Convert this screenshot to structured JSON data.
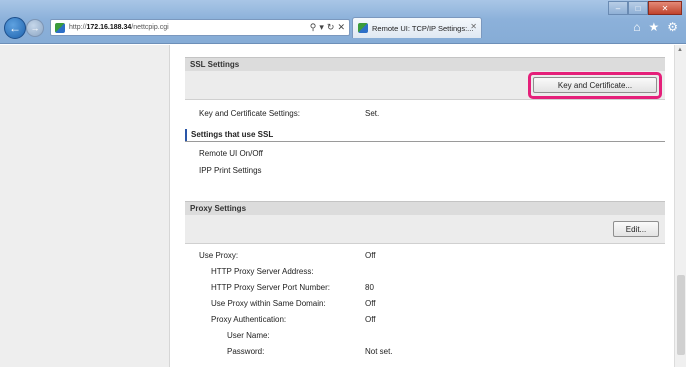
{
  "browser": {
    "url_prefix": "http://",
    "url_host": "172.16.188.34",
    "url_path": "/nettcpip.cgi",
    "tab_title": "Remote UI: TCP/IP Settings:..."
  },
  "ssl": {
    "header": "SSL Settings",
    "key_cert_button": "Key and Certificate...",
    "key_cert_label": "Key and Certificate Settings:",
    "key_cert_value": "Set.",
    "subsection": "Settings that use SSL",
    "links": [
      "Remote UI On/Off",
      "IPP Print Settings"
    ]
  },
  "proxy": {
    "header": "Proxy Settings",
    "edit_button": "Edit...",
    "rows": [
      {
        "label": "Use Proxy:",
        "value": "Off"
      },
      {
        "label": "HTTP Proxy Server Address:",
        "value": ""
      },
      {
        "label": "HTTP Proxy Server Port Number:",
        "value": "80"
      },
      {
        "label": "Use Proxy within Same Domain:",
        "value": "Off"
      },
      {
        "label": "Proxy Authentication:",
        "value": "Off"
      },
      {
        "label": "User Name:",
        "value": ""
      },
      {
        "label": "Password:",
        "value": "Not set."
      }
    ]
  }
}
